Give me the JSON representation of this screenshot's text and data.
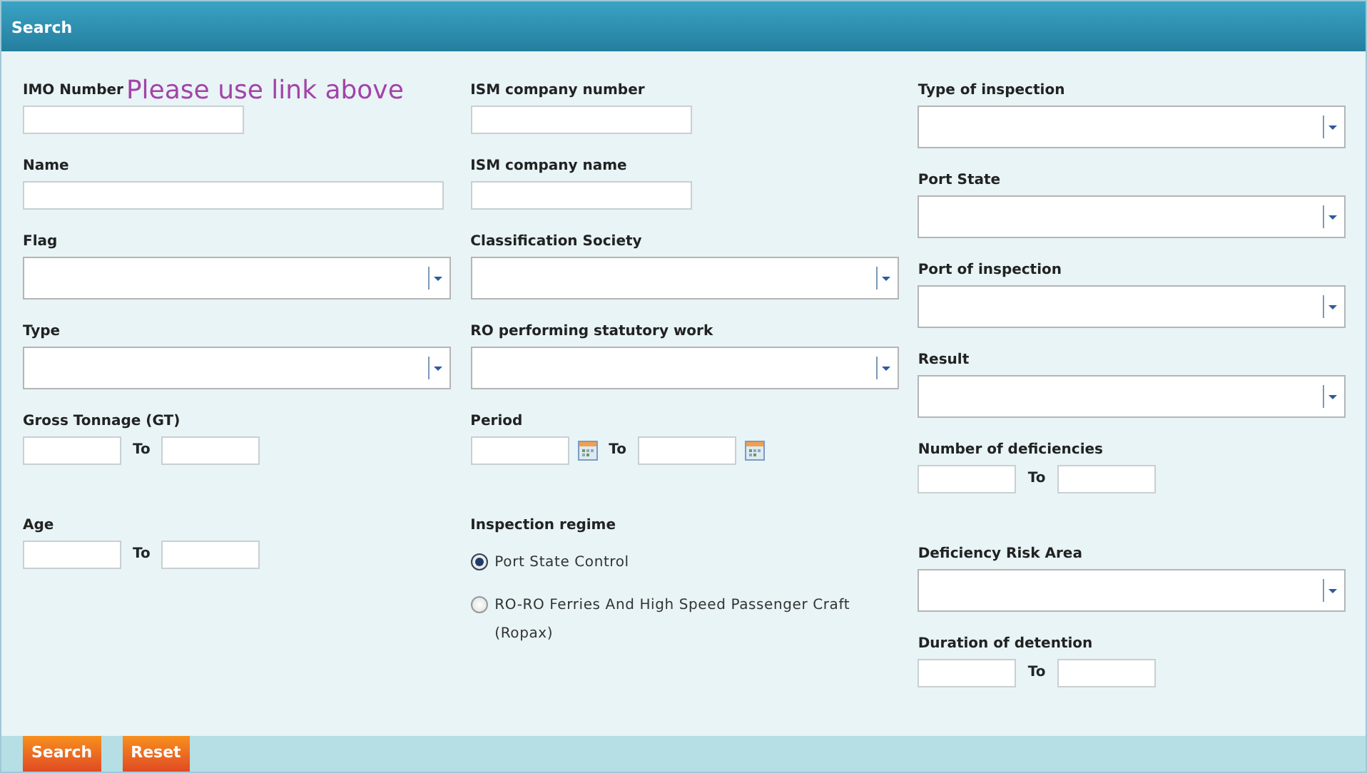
{
  "header": {
    "title": "Search"
  },
  "columns": [
    {
      "fields": [
        {
          "kind": "short_text",
          "label": "IMO Number",
          "note": "Please use link above"
        },
        {
          "kind": "long_text",
          "label": "Name"
        },
        {
          "kind": "select",
          "label": "Flag"
        },
        {
          "kind": "select",
          "label": "Type"
        },
        {
          "kind": "range",
          "label": "Gross Tonnage (GT)",
          "to": "To"
        },
        {
          "kind": "range",
          "label": "Age",
          "to": "To"
        }
      ]
    },
    {
      "fields": [
        {
          "kind": "short_text",
          "label": "ISM company number"
        },
        {
          "kind": "short_text",
          "label": "ISM company name"
        },
        {
          "kind": "select",
          "label": "Classification Society"
        },
        {
          "kind": "select",
          "label": "RO performing statutory work"
        },
        {
          "kind": "daterange",
          "label": "Period",
          "to": "To"
        },
        {
          "kind": "radio",
          "label": "Inspection regime",
          "options": [
            {
              "label": "Port State Control",
              "selected": true
            },
            {
              "label": "RO-RO Ferries And High Speed Passenger Craft (Ropax)",
              "selected": false
            }
          ]
        }
      ]
    },
    {
      "fields": [
        {
          "kind": "select",
          "label": "Type of inspection"
        },
        {
          "kind": "select",
          "label": "Port State"
        },
        {
          "kind": "select",
          "label": "Port of inspection"
        },
        {
          "kind": "select",
          "label": "Result"
        },
        {
          "kind": "range",
          "label": "Number of deficiencies",
          "to": "To"
        },
        {
          "kind": "select",
          "label": "Deficiency Risk Area"
        },
        {
          "kind": "range",
          "label": "Duration of detention",
          "to": "To"
        }
      ]
    }
  ],
  "buttons": [
    {
      "label": "Search"
    },
    {
      "label": "Reset"
    }
  ]
}
